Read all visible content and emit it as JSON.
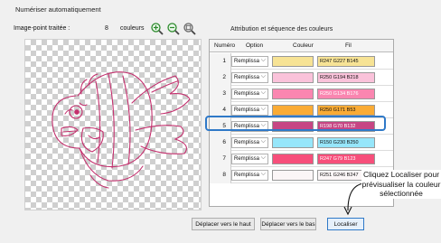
{
  "title": "Numériser automatiquement",
  "left_bar": {
    "label": "Image-point traitée :",
    "count": "8",
    "unit": "couleurs"
  },
  "icons": {
    "zoom_in": "zoom-in-icon",
    "zoom_out": "zoom-out-icon",
    "zoom_fit": "zoom-fit-icon"
  },
  "right_title": "Attribution et séquence des couleurs",
  "table": {
    "columns": [
      "Numéro",
      "Option",
      "Couleur",
      "Fil"
    ],
    "rows": [
      {
        "num": "1",
        "option": "Remplissa",
        "color": "#f7e395",
        "thread": "R247 G227 B145"
      },
      {
        "num": "2",
        "option": "Remplissa",
        "color": "#fac2da",
        "thread": "R250 G194 B218"
      },
      {
        "num": "3",
        "option": "Remplissa",
        "color": "#fa86b0",
        "thread": "R250 G134 B176"
      },
      {
        "num": "4",
        "option": "Remplissa",
        "color": "#faab35",
        "thread": "R250 G171 B53"
      },
      {
        "num": "5",
        "option": "Remplissa",
        "color": "#c64684",
        "thread": "R198 G70 B132"
      },
      {
        "num": "6",
        "option": "Remplissa",
        "color": "#96e6fa",
        "thread": "R150 G230 B250"
      },
      {
        "num": "7",
        "option": "Remplissa",
        "color": "#f74f7b",
        "thread": "R247 G79 B123"
      },
      {
        "num": "8",
        "option": "Remplissa",
        "color": "#fbf6f7",
        "thread": "R251 G246 B247"
      }
    ],
    "selected_index": 4
  },
  "buttons": {
    "move_up": "Déplacer vers le haut",
    "move_down": "Déplacer vers le bas",
    "locate": "Localiser"
  },
  "callout": "Cliquez Localiser pour prévisualiser la couleur sélectionnée",
  "colors": {
    "highlight": "#2f79c8",
    "outline": "#c4306e"
  }
}
